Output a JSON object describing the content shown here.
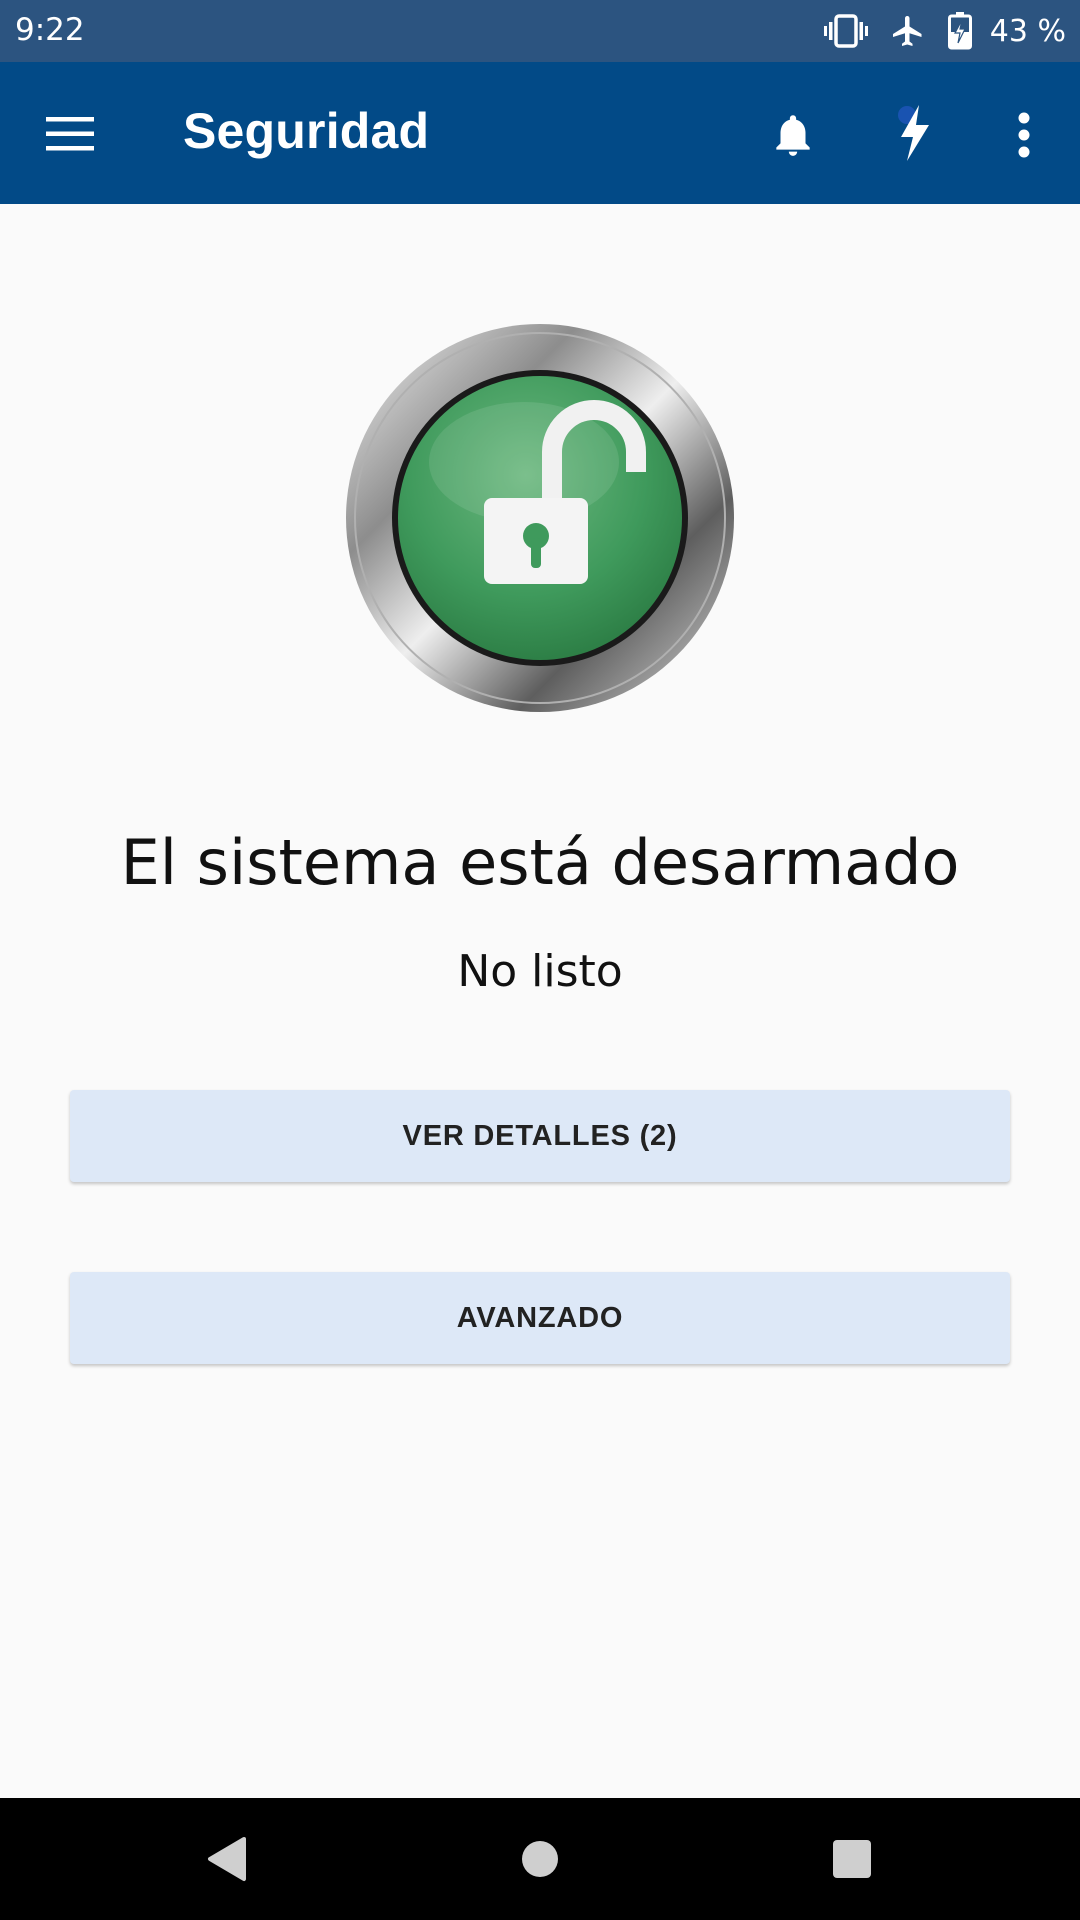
{
  "status_bar": {
    "time": "9:22",
    "battery_percent": "43 %",
    "icons": [
      "vibrate-icon",
      "airplane-mode-icon",
      "battery-charging-icon"
    ]
  },
  "app_bar": {
    "title": "Seguridad",
    "icons": [
      "menu-icon",
      "bell-icon",
      "bolt-icon",
      "more-vert-icon"
    ],
    "color": "#024a87"
  },
  "main": {
    "lock_icon": "unlocked-padlock-icon",
    "lock_color": "#3f9a5c",
    "status_title": "El sistema está desarmado",
    "status_subtitle": "No listo",
    "buttons": {
      "details": "VER DETALLES (2)",
      "advanced": "AVANZADO"
    }
  },
  "nav_bar": {
    "icons": [
      "back-icon",
      "home-icon",
      "recents-icon"
    ]
  }
}
